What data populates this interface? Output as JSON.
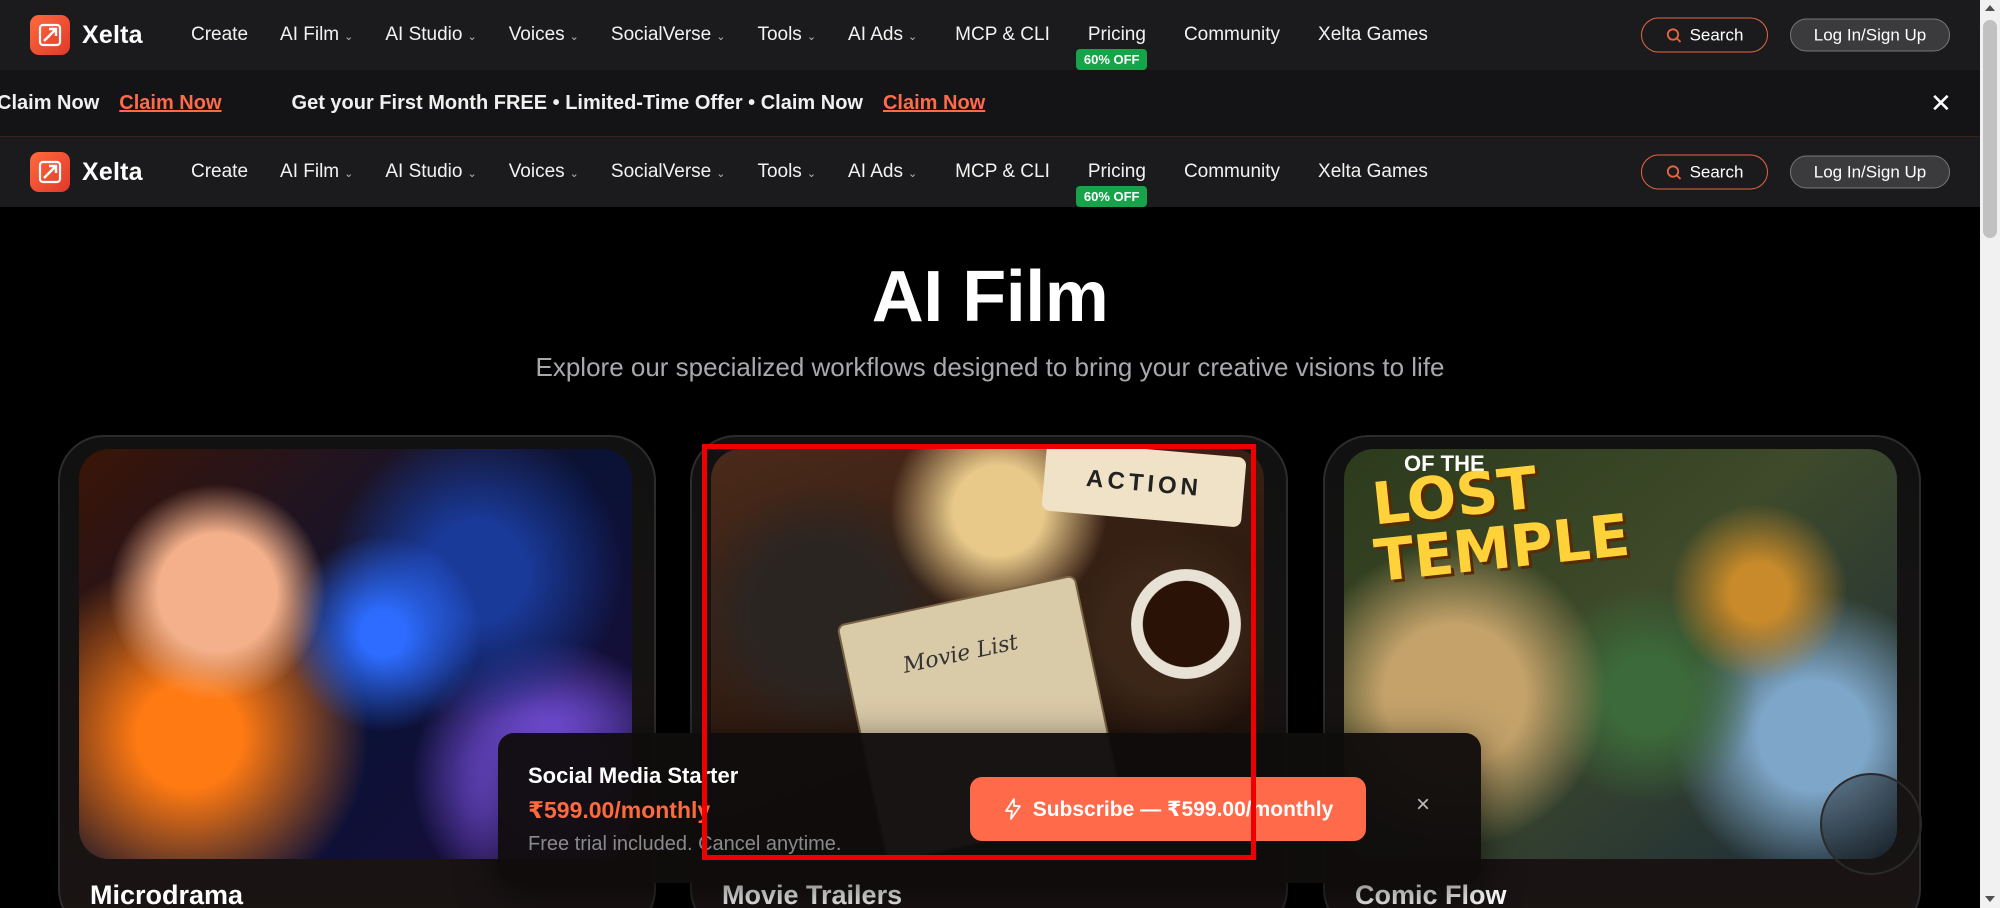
{
  "brand": {
    "name": "Xelta",
    "logo_icon": "xelta-logo-icon"
  },
  "nav": {
    "items": [
      {
        "label": "Create",
        "dropdown": false
      },
      {
        "label": "AI Film",
        "dropdown": true
      },
      {
        "label": "AI Studio",
        "dropdown": true
      },
      {
        "label": "Voices",
        "dropdown": true
      },
      {
        "label": "SocialVerse",
        "dropdown": true
      },
      {
        "label": "Tools",
        "dropdown": true
      },
      {
        "label": "AI Ads",
        "dropdown": true
      },
      {
        "label": "MCP & CLI",
        "dropdown": false
      },
      {
        "label": "Pricing",
        "dropdown": false
      },
      {
        "label": "Community",
        "dropdown": false
      },
      {
        "label": "Xelta Games",
        "dropdown": false
      }
    ],
    "pricing_badge": "60% OFF",
    "search_label": "Search",
    "login_label": "Log In/Sign Up"
  },
  "promo": {
    "lead_text": "er • Claim Now",
    "lead_link": "Claim Now",
    "text": "Get your First Month FREE • Limited-Time Offer • Claim Now",
    "link": "Claim Now",
    "close_icon": "close-icon"
  },
  "hero": {
    "title": "AI Film",
    "subtitle": "Explore our specialized workflows designed to bring your creative visions to life"
  },
  "cards": [
    {
      "title": "Microdrama"
    },
    {
      "title": "Movie Trailers",
      "sign_text": "ACTION",
      "notebook_text": "Movie List"
    },
    {
      "title": "Comic Flow",
      "caption_line1": "OF THE",
      "caption_line2": "LOST",
      "caption_line3": "TEMPLE"
    }
  ],
  "popup": {
    "plan": "Social Media Starter",
    "price": "₹599.00/monthly",
    "note": "Free trial included. Cancel anytime.",
    "button_label": "Subscribe — ₹599.00/monthly",
    "close": "×"
  },
  "colors": {
    "accent": "#ff6a4a",
    "badge_green": "#17a34a",
    "highlight_red": "#ee0000"
  }
}
